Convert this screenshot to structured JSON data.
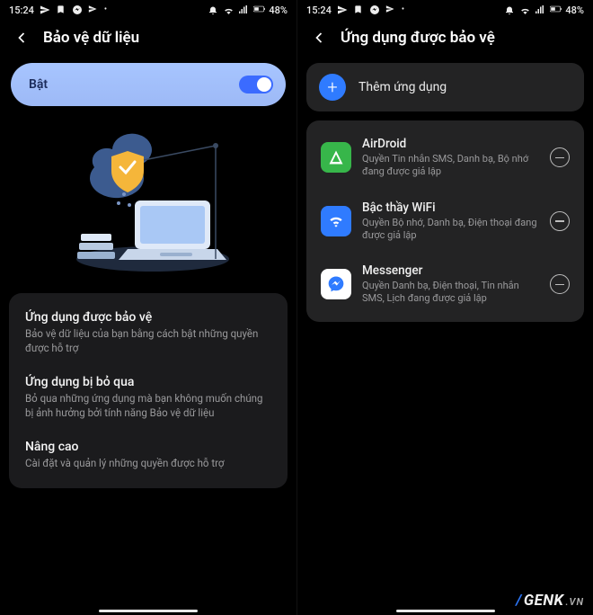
{
  "status": {
    "time": "15:24",
    "battery": "48%"
  },
  "left": {
    "title": "Bảo vệ dữ liệu",
    "toggle_label": "Bật",
    "items": [
      {
        "title": "Ứng dụng được bảo vệ",
        "sub": "Bảo vệ dữ liệu của bạn bằng cách bật những quyền được hỗ trợ"
      },
      {
        "title": "Ứng dụng bị bỏ qua",
        "sub": "Bỏ qua những ứng dụng mà bạn không muốn chúng bị ảnh hưởng bởi tính năng Bảo vệ dữ liệu"
      },
      {
        "title": "Nâng cao",
        "sub": "Cài đặt và quản lý những quyền được hỗ trợ"
      }
    ]
  },
  "right": {
    "title": "Ứng dụng được bảo vệ",
    "add_label": "Thêm ứng dụng",
    "apps": [
      {
        "name": "AirDroid",
        "sub": "Quyền Tin nhắn SMS, Danh bạ, Bộ nhớ đang được giả lập",
        "color": "#37b64a"
      },
      {
        "name": "Bậc thầy WiFi",
        "sub": "Quyền Bộ nhớ, Danh bạ, Điện thoại đang được giả lập",
        "color": "#2f7bff"
      },
      {
        "name": "Messenger",
        "sub": "Quyền Danh bạ, Điện thoại, Tin nhắn SMS, Lịch đang được giả lập",
        "color": "#ffffff"
      }
    ]
  },
  "watermark": {
    "brand": "GENK",
    "tld": ".VN"
  }
}
